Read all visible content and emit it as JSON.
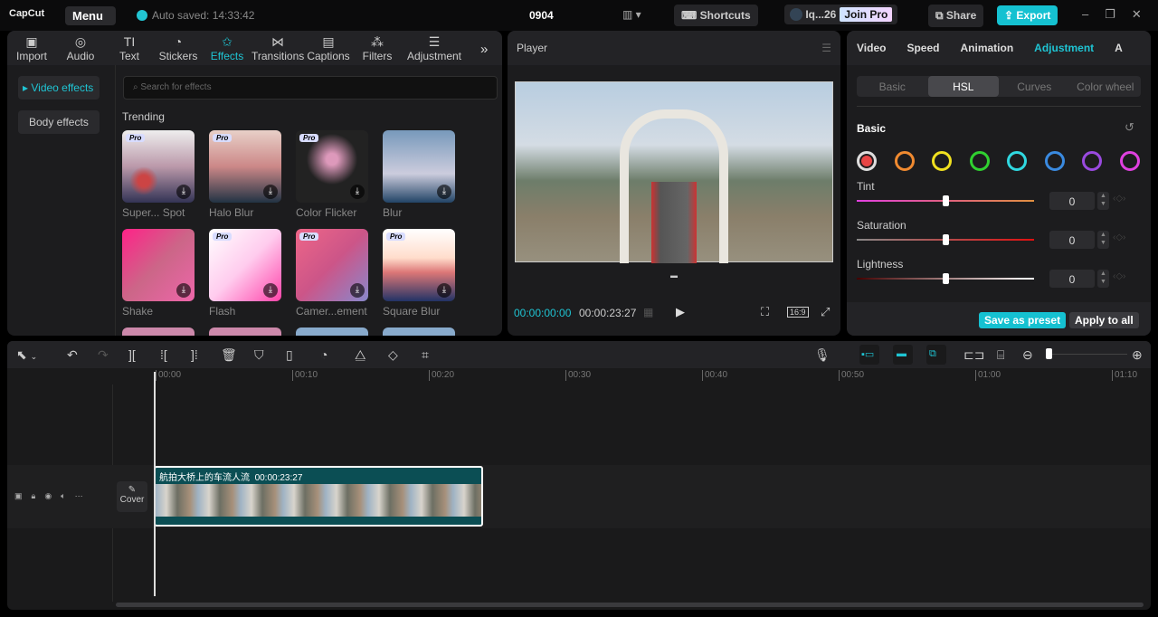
{
  "app": {
    "logo": "CapCut",
    "menu": "Menu",
    "autosave": "Auto saved: 14:33:42",
    "project_title": "0904",
    "shortcuts": "Shortcuts",
    "user": "Iq...26",
    "join_pro": "Join Pro",
    "share": "Share",
    "export": "Export"
  },
  "toolbar_tabs": [
    {
      "label": "Import",
      "icon": "import-icon"
    },
    {
      "label": "Audio",
      "icon": "audio-icon"
    },
    {
      "label": "Text",
      "icon": "text-icon"
    },
    {
      "label": "Stickers",
      "icon": "sticker-icon"
    },
    {
      "label": "Effects",
      "icon": "effects-icon",
      "active": true
    },
    {
      "label": "Transitions",
      "icon": "transitions-icon"
    },
    {
      "label": "Captions",
      "icon": "captions-icon"
    },
    {
      "label": "Filters",
      "icon": "filters-icon"
    },
    {
      "label": "Adjustment",
      "icon": "adjustment-icon"
    }
  ],
  "effects": {
    "side": [
      "Video effects",
      "Body effects"
    ],
    "search_placeholder": "Search for effects",
    "section": "Trending",
    "pro_label": "Pro",
    "items": [
      {
        "name": "Super... Spot",
        "pro": true
      },
      {
        "name": "Halo Blur",
        "pro": true
      },
      {
        "name": "Color Flicker",
        "pro": true
      },
      {
        "name": "Blur",
        "pro": false
      },
      {
        "name": "Shake",
        "pro": false
      },
      {
        "name": "Flash",
        "pro": true
      },
      {
        "name": "Camer...ement",
        "pro": true
      },
      {
        "name": "Square Blur",
        "pro": true
      }
    ]
  },
  "player": {
    "title": "Player",
    "current_time": "00:00:00:00",
    "total_time": "00:00:23:27",
    "ratio": "16:9"
  },
  "inspector": {
    "tabs": [
      "Video",
      "Speed",
      "Animation",
      "Adjustment",
      "A"
    ],
    "active_tab": "Adjustment",
    "subtabs": [
      "Basic",
      "HSL",
      "Curves",
      "Color wheel"
    ],
    "active_subtab": "HSL",
    "section": "Basic",
    "colors": [
      "#e84545",
      "#f08a30",
      "#f0e020",
      "#30d030",
      "#30d8e0",
      "#3a8ae0",
      "#9a4ae0",
      "#e040e0"
    ],
    "sliders": [
      {
        "label": "Tint",
        "value": "0"
      },
      {
        "label": "Saturation",
        "value": "0"
      },
      {
        "label": "Lightness",
        "value": "0"
      }
    ],
    "save_preset": "Save as preset",
    "apply_all": "Apply to all"
  },
  "timeline": {
    "ruler": [
      "00:00",
      "00:10",
      "00:20",
      "00:30",
      "00:40",
      "00:50",
      "01:00",
      "01:10"
    ],
    "clip_title": "航拍大桥上的车流人流",
    "clip_duration": "00:00:23:27",
    "cover": "Cover"
  }
}
